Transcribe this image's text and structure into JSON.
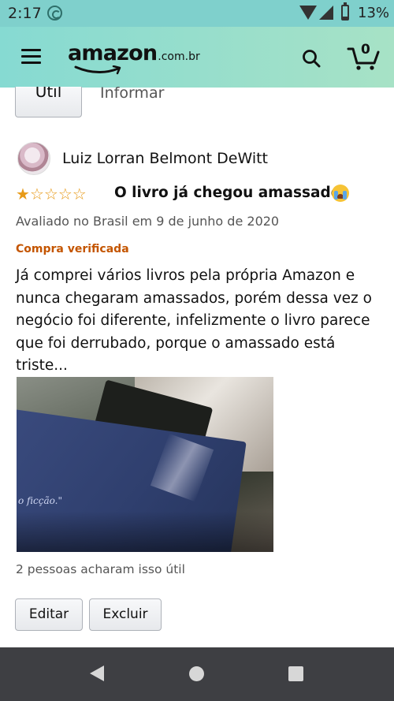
{
  "status_bar": {
    "time": "2:17",
    "battery_percent": "13%",
    "battery_level": 0.13
  },
  "header": {
    "logo_text": "amazon",
    "logo_suffix": ".com.br",
    "cart_count": "0",
    "brand_colors": {
      "bar_start": "#86dad2",
      "bar_end": "#a7e2c6"
    }
  },
  "previous_review_actions": {
    "util_label": "Útil",
    "informar_label": "Informar"
  },
  "review": {
    "reviewer_name": "Luiz Lorran Belmont DeWitt",
    "rating": 1,
    "max_rating": 5,
    "title": "O livro já chegou amassado",
    "title_emoji": "crying-face",
    "date_line": "Avaliado no Brasil em 9 de junho de 2020",
    "verified_label": "Compra verificada",
    "body": "Já comprei vários livros pela própria Amazon e nunca chegaram amassados, porém dessa vez o negócio foi diferente, infelizmente o livro parece que foi derrubado, porque o amassado está triste...",
    "photo_text": "o ficção.\"",
    "helpful_text": "2 pessoas acharam isso útil",
    "edit_label": "Editar",
    "delete_label": "Excluir"
  },
  "colors": {
    "star": "#e79a18",
    "verified": "#c45500",
    "android_nav": "#3e3f43"
  }
}
